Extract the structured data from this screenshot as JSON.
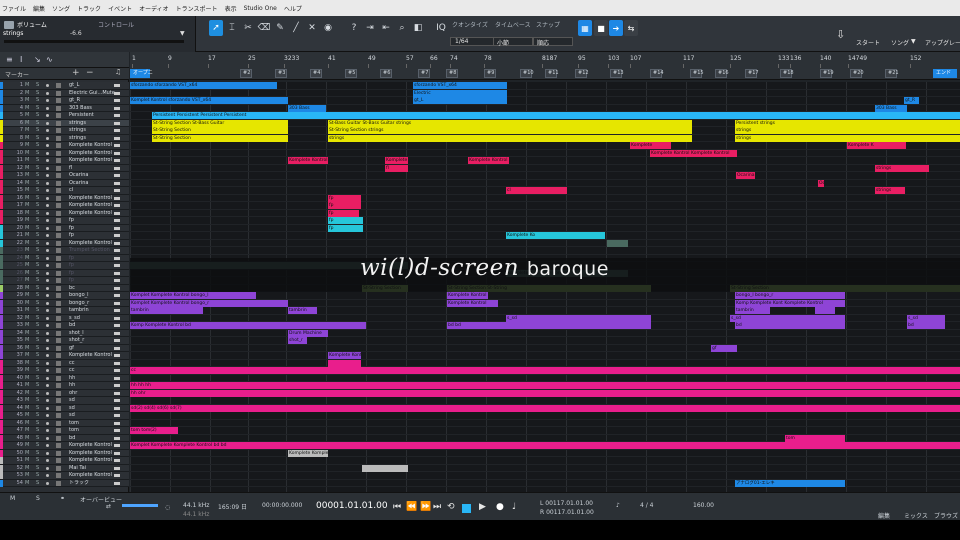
{
  "menu": [
    "ファイル",
    "編集",
    "ソング",
    "トラック",
    "イベント",
    "オーディオ",
    "トランスポート",
    "表示",
    "Studio One",
    "ヘルプ"
  ],
  "inspector": {
    "volume_label": "ボリューム",
    "control_label": "コントロール",
    "track_name": "strings",
    "volume_value": "-6.6"
  },
  "quantize": {
    "label": "クオンタイズ",
    "value": "1/64"
  },
  "timebase": {
    "label": "タイムベース",
    "value": "小節"
  },
  "snap": {
    "label": "スナップ",
    "value": "順応"
  },
  "right_buttons": {
    "start": "スタート",
    "song": "ソング",
    "upgrade": "アップグレード"
  },
  "tracklist": {
    "marker_label": "マーカー"
  },
  "ruler": {
    "bars": [
      "1",
      "9",
      "17",
      "25",
      "3233",
      "41",
      "49",
      "57",
      "66",
      "74",
      "78",
      "8187",
      "95",
      "103",
      "107",
      "117",
      "125",
      "133",
      "136",
      "140",
      "14749",
      "152"
    ],
    "markers": [
      "オープニ",
      "#2",
      "#3",
      "#4",
      "#5",
      "#6",
      "#7",
      "#8",
      "#9",
      "#10",
      "#11",
      "#12",
      "#13",
      "#14",
      "#15",
      "#16",
      "#17",
      "#18",
      "#19",
      "#20",
      "#21",
      "エンド"
    ]
  },
  "tracks": [
    {
      "n": "1",
      "name": "gt_L",
      "color": "#1e88e5"
    },
    {
      "n": "2",
      "name": "Electric Gui...Mute",
      "color": "#1e88e5"
    },
    {
      "n": "3",
      "name": "gt_R",
      "color": "#1e88e5"
    },
    {
      "n": "4",
      "name": "303 Bass",
      "color": "#1e88e5"
    },
    {
      "n": "5",
      "name": "Persistent",
      "color": "#29b6f6"
    },
    {
      "n": "6",
      "name": "strings",
      "color": "#e6e600",
      "sel": true
    },
    {
      "n": "7",
      "name": "strings",
      "color": "#e6e600"
    },
    {
      "n": "8",
      "name": "strings",
      "color": "#e6e600"
    },
    {
      "n": "9",
      "name": "Komplete Kontrol",
      "color": "#e91e63"
    },
    {
      "n": "10",
      "name": "Komplete Kontrol",
      "color": "#e91e63"
    },
    {
      "n": "11",
      "name": "Komplete Kontrol",
      "color": "#e91e63"
    },
    {
      "n": "12",
      "name": "fl",
      "color": "#e91e63"
    },
    {
      "n": "13",
      "name": "Ocarina",
      "color": "#e91e63"
    },
    {
      "n": "14",
      "name": "Ocarina",
      "color": "#e91e63"
    },
    {
      "n": "15",
      "name": "cl",
      "color": "#e91e63"
    },
    {
      "n": "16",
      "name": "Komplete Kontrol",
      "color": "#e91e63"
    },
    {
      "n": "17",
      "name": "Komplete Kontrol",
      "color": "#e91e63"
    },
    {
      "n": "18",
      "name": "Komplete Kontrol",
      "color": "#e91e63"
    },
    {
      "n": "19",
      "name": "fp",
      "color": "#e91e63"
    },
    {
      "n": "20",
      "name": "fp",
      "color": "#26c6da"
    },
    {
      "n": "21",
      "name": "fp",
      "color": "#26c6da"
    },
    {
      "n": "22",
      "name": "Komplete Kontrol",
      "color": "#26c6da"
    },
    {
      "n": "23",
      "name": "Trumpet Section",
      "color": "#4a6a60",
      "dim": true
    },
    {
      "n": "24",
      "name": "fp",
      "color": "#4a6a60",
      "dim": true
    },
    {
      "n": "25",
      "name": "fp",
      "color": "#4a6a60",
      "dim": true
    },
    {
      "n": "26",
      "name": "fp",
      "color": "#4a6a60",
      "dim": true
    },
    {
      "n": "27",
      "name": "fp",
      "color": "#4a6a60",
      "dim": true
    },
    {
      "n": "28",
      "name": "bc",
      "color": "#9ccc65"
    },
    {
      "n": "29",
      "name": "bongo_l",
      "color": "#8e44d6"
    },
    {
      "n": "30",
      "name": "bongo_r",
      "color": "#8e44d6"
    },
    {
      "n": "31",
      "name": "tambrin",
      "color": "#8e44d6"
    },
    {
      "n": "32",
      "name": "s_sd",
      "color": "#8e44d6"
    },
    {
      "n": "33",
      "name": "bd",
      "color": "#8e44d6"
    },
    {
      "n": "34",
      "name": "shot_l",
      "color": "#8e44d6"
    },
    {
      "n": "35",
      "name": "shot_r",
      "color": "#8e44d6"
    },
    {
      "n": "36",
      "name": "gf",
      "color": "#8e44d6"
    },
    {
      "n": "37",
      "name": "Komplete Kontrol",
      "color": "#8e44d6"
    },
    {
      "n": "38",
      "name": "cc",
      "color": "#e91e8c"
    },
    {
      "n": "39",
      "name": "cc",
      "color": "#e91e8c"
    },
    {
      "n": "40",
      "name": "hh",
      "color": "#e91e8c"
    },
    {
      "n": "41",
      "name": "hh",
      "color": "#e91e8c"
    },
    {
      "n": "42",
      "name": "ohr",
      "color": "#e91e8c"
    },
    {
      "n": "43",
      "name": "sd",
      "color": "#e91e8c"
    },
    {
      "n": "44",
      "name": "sd",
      "color": "#e91e8c"
    },
    {
      "n": "45",
      "name": "sd",
      "color": "#e91e8c"
    },
    {
      "n": "46",
      "name": "tom",
      "color": "#e91e8c"
    },
    {
      "n": "47",
      "name": "tom",
      "color": "#e91e8c"
    },
    {
      "n": "48",
      "name": "bd",
      "color": "#e91e8c"
    },
    {
      "n": "49",
      "name": "Komplete Kontrol",
      "color": "#e91e8c"
    },
    {
      "n": "50",
      "name": "Komplete Kontrol",
      "color": "#e91e8c"
    },
    {
      "n": "51",
      "name": "Komplete Kontrol",
      "color": "#bbbbbb"
    },
    {
      "n": "52",
      "name": "Mai Tai",
      "color": "#bbbbbb"
    },
    {
      "n": "53",
      "name": "Komplete Kontrol",
      "color": "#bbbbbb"
    },
    {
      "n": "54",
      "name": "トラック",
      "color": "#1e88e5"
    }
  ],
  "clips": [
    {
      "row": 0,
      "s": 0,
      "e": 147,
      "c": "#1e88e5",
      "t": "sforzando  sforzando VST_x64"
    },
    {
      "row": 0,
      "s": 283,
      "e": 377,
      "c": "#1e88e5",
      "t": "sforzando VST_x64"
    },
    {
      "row": 1,
      "s": 283,
      "e": 377,
      "c": "#1e88e5",
      "t": "Electric"
    },
    {
      "row": 2,
      "s": 0,
      "e": 158,
      "c": "#1e88e5",
      "t": "Komplet Kontrol  sforzando VST_x64"
    },
    {
      "row": 2,
      "s": 283,
      "e": 377,
      "c": "#1e88e5",
      "t": "gt_L"
    },
    {
      "row": 2,
      "s": 774,
      "e": 789,
      "c": "#1e88e5",
      "t": "gt_R"
    },
    {
      "row": 3,
      "s": 158,
      "e": 196,
      "c": "#1e88e5",
      "t": "303 Bass"
    },
    {
      "row": 3,
      "s": 745,
      "e": 777,
      "c": "#1e88e5",
      "t": "303 Bass"
    },
    {
      "row": 4,
      "s": 22,
      "e": 830,
      "c": "#29b6f6",
      "t": "Persistent  Persistent  Persistent  Persistent"
    },
    {
      "row": 5,
      "s": 22,
      "e": 158,
      "c": "#e6e600",
      "t": "St-String Section  St-Bass Guitar"
    },
    {
      "row": 5,
      "s": 198,
      "e": 562,
      "c": "#e6e600",
      "t": "St-Bass Guitar  St-Bass Guitar  strings"
    },
    {
      "row": 5,
      "s": 605,
      "e": 830,
      "c": "#e6e600",
      "t": "Persistent  strings"
    },
    {
      "row": 6,
      "s": 22,
      "e": 158,
      "c": "#e6e600",
      "t": "St-String Section"
    },
    {
      "row": 6,
      "s": 198,
      "e": 562,
      "c": "#e6e600",
      "t": "St-String Section  strings"
    },
    {
      "row": 6,
      "s": 605,
      "e": 830,
      "c": "#e6e600",
      "t": "strings"
    },
    {
      "row": 7,
      "s": 22,
      "e": 158,
      "c": "#e6e600",
      "t": "St-String Section"
    },
    {
      "row": 7,
      "s": 198,
      "e": 562,
      "c": "#e6e600",
      "t": "strings"
    },
    {
      "row": 7,
      "s": 605,
      "e": 830,
      "c": "#e6e600",
      "t": "strings"
    },
    {
      "row": 8,
      "s": 500,
      "e": 541,
      "c": "#e91e63",
      "t": "Komplete"
    },
    {
      "row": 8,
      "s": 717,
      "e": 776,
      "c": "#e91e63",
      "t": "Komplete K"
    },
    {
      "row": 9,
      "s": 520,
      "e": 607,
      "c": "#e91e63",
      "t": "Komplete Kontrol  Komplete Kontrol"
    },
    {
      "row": 10,
      "s": 158,
      "e": 198,
      "c": "#e91e63",
      "t": "Komplete Kontrol"
    },
    {
      "row": 10,
      "s": 255,
      "e": 278,
      "c": "#e91e63",
      "t": "Komplete"
    },
    {
      "row": 10,
      "s": 338,
      "e": 379,
      "c": "#e91e63",
      "t": "Komplete Kontrol"
    },
    {
      "row": 11,
      "s": 255,
      "e": 278,
      "c": "#e91e63",
      "t": "fl"
    },
    {
      "row": 11,
      "s": 745,
      "e": 799,
      "c": "#e91e63",
      "t": "strings"
    },
    {
      "row": 12,
      "s": 606,
      "e": 625,
      "c": "#e91e63",
      "t": "Ocarina"
    },
    {
      "row": 13,
      "s": 688,
      "e": 694,
      "c": "#e91e63",
      "t": "Ocl"
    },
    {
      "row": 14,
      "s": 376,
      "e": 437,
      "c": "#e91e63",
      "t": "cl"
    },
    {
      "row": 14,
      "s": 745,
      "e": 775,
      "c": "#e91e63",
      "t": "strings"
    },
    {
      "row": 15,
      "s": 198,
      "e": 231,
      "c": "#e91e63",
      "t": "fp"
    },
    {
      "row": 16,
      "s": 198,
      "e": 231,
      "c": "#e91e63",
      "t": "fp"
    },
    {
      "row": 17,
      "s": 198,
      "e": 229,
      "c": "#e91e63",
      "t": "fp"
    },
    {
      "row": 18,
      "s": 198,
      "e": 233,
      "c": "#26c6da",
      "t": "fp"
    },
    {
      "row": 19,
      "s": 198,
      "e": 233,
      "c": "#26c6da",
      "t": "fp"
    },
    {
      "row": 20,
      "s": 376,
      "e": 475,
      "c": "#26c6da",
      "t": "Komplete Ko"
    },
    {
      "row": 21,
      "s": 477,
      "e": 498,
      "c": "#4a6a60",
      "t": ""
    },
    {
      "row": 24,
      "s": 0,
      "e": 278,
      "c": "#4a6a60",
      "t": ""
    },
    {
      "row": 25,
      "s": 376,
      "e": 498,
      "c": "#4a6a60",
      "t": "Komplete Komplete Kontrol"
    },
    {
      "row": 27,
      "s": 232,
      "e": 278,
      "c": "#9ccc65",
      "t": "St-String Section"
    },
    {
      "row": 27,
      "s": 317,
      "e": 521,
      "c": "#9ccc65",
      "t": "St-String Section  St-String"
    },
    {
      "row": 27,
      "s": 600,
      "e": 830,
      "c": "#9ccc65",
      "t": "St-String Section"
    },
    {
      "row": 28,
      "s": 0,
      "e": 126,
      "c": "#8e44d6",
      "t": "Komplet Komplete Kontrol  bongo_l"
    },
    {
      "row": 28,
      "s": 317,
      "e": 358,
      "c": "#8e44d6",
      "t": "Komplete Kontrol"
    },
    {
      "row": 28,
      "s": 605,
      "e": 715,
      "c": "#8e44d6",
      "t": "bongo_l  bongo_r"
    },
    {
      "row": 29,
      "s": 0,
      "e": 158,
      "c": "#8e44d6",
      "t": "Komplet Komplete Kontrol  bongo_r"
    },
    {
      "row": 29,
      "s": 317,
      "e": 368,
      "c": "#8e44d6",
      "t": "Komplete Kontrol"
    },
    {
      "row": 29,
      "s": 605,
      "e": 715,
      "c": "#8e44d6",
      "t": "Komp Komplete Kont Komplete Kontrol"
    },
    {
      "row": 30,
      "s": 0,
      "e": 73,
      "c": "#8e44d6",
      "t": "tambrin"
    },
    {
      "row": 30,
      "s": 158,
      "e": 187,
      "c": "#8e44d6",
      "t": "tambrin"
    },
    {
      "row": 30,
      "s": 605,
      "e": 640,
      "c": "#8e44d6",
      "t": "tambrin"
    },
    {
      "row": 30,
      "s": 685,
      "e": 705,
      "c": "#8e44d6",
      "t": ""
    },
    {
      "row": 31,
      "s": 376,
      "e": 521,
      "c": "#8e44d6",
      "t": "s_sd"
    },
    {
      "row": 31,
      "s": 600,
      "e": 715,
      "c": "#8e44d6",
      "t": "s_sd"
    },
    {
      "row": 31,
      "s": 777,
      "e": 815,
      "c": "#8e44d6",
      "t": "s_sd"
    },
    {
      "row": 32,
      "s": 0,
      "e": 236,
      "c": "#8e44d6",
      "t": "Komp Komplete Kontrol  bd"
    },
    {
      "row": 32,
      "s": 317,
      "e": 521,
      "c": "#8e44d6",
      "t": "bd  bd"
    },
    {
      "row": 32,
      "s": 605,
      "e": 715,
      "c": "#8e44d6",
      "t": "bd"
    },
    {
      "row": 32,
      "s": 777,
      "e": 815,
      "c": "#8e44d6",
      "t": "bd"
    },
    {
      "row": 33,
      "s": 158,
      "e": 198,
      "c": "#8e44d6",
      "t": "Drum Machine"
    },
    {
      "row": 34,
      "s": 158,
      "e": 177,
      "c": "#8e44d6",
      "t": "shot_r"
    },
    {
      "row": 35,
      "s": 581,
      "e": 607,
      "c": "#8e44d6",
      "t": "gf"
    },
    {
      "row": 36,
      "s": 198,
      "e": 231,
      "c": "#8e44d6",
      "t": "Komplete Kont"
    },
    {
      "row": 37,
      "s": 198,
      "e": 231,
      "c": "#e91e8c",
      "t": ""
    },
    {
      "row": 38,
      "s": 0,
      "e": 830,
      "c": "#e91e8c",
      "t": "cc"
    },
    {
      "row": 40,
      "s": 0,
      "e": 830,
      "c": "#e91e8c",
      "t": "hh  hh  hh"
    },
    {
      "row": 41,
      "s": 0,
      "e": 830,
      "c": "#e91e8c",
      "t": "hh  ohr"
    },
    {
      "row": 43,
      "s": 0,
      "e": 830,
      "c": "#e91e8c",
      "t": "sd(2)  sd(4)  sd(6)  sd(7)"
    },
    {
      "row": 46,
      "s": 0,
      "e": 48,
      "c": "#e91e8c",
      "t": "tom  tom(2)"
    },
    {
      "row": 47,
      "s": 655,
      "e": 715,
      "c": "#e91e8c",
      "t": "tom"
    },
    {
      "row": 48,
      "s": 0,
      "e": 830,
      "c": "#e91e8c",
      "t": "Komplet Komplete Komplete Kontrol  bd  bd"
    },
    {
      "row": 49,
      "s": 158,
      "e": 198,
      "c": "#bbbbbb",
      "t": "Komplete Komplete"
    },
    {
      "row": 51,
      "s": 232,
      "e": 278,
      "c": "#bbbbbb",
      "t": ""
    },
    {
      "row": 53,
      "s": 605,
      "e": 715,
      "c": "#1e88e5",
      "t": "アナログ01-エレキ"
    }
  ],
  "watermark": {
    "italic": "wi(l)d-screen",
    "roman": "baroque"
  },
  "bottom": {
    "m": "M",
    "s": "S",
    "overview": "オーバービュー",
    "sample_rate": "44.1 kHz",
    "length": "165:09 日",
    "rate_sub": "44.1 kHz",
    "time": "00:00:00.000",
    "bars_pos": "00001.01.01.00",
    "loop_l": "L 00117.01.01.00",
    "loop_r": "R 00117.01.01.00",
    "signature": "4 / 4",
    "tempo": "160.00",
    "edit": "編集",
    "mix": "ミックス",
    "browse": "ブラウズ"
  }
}
